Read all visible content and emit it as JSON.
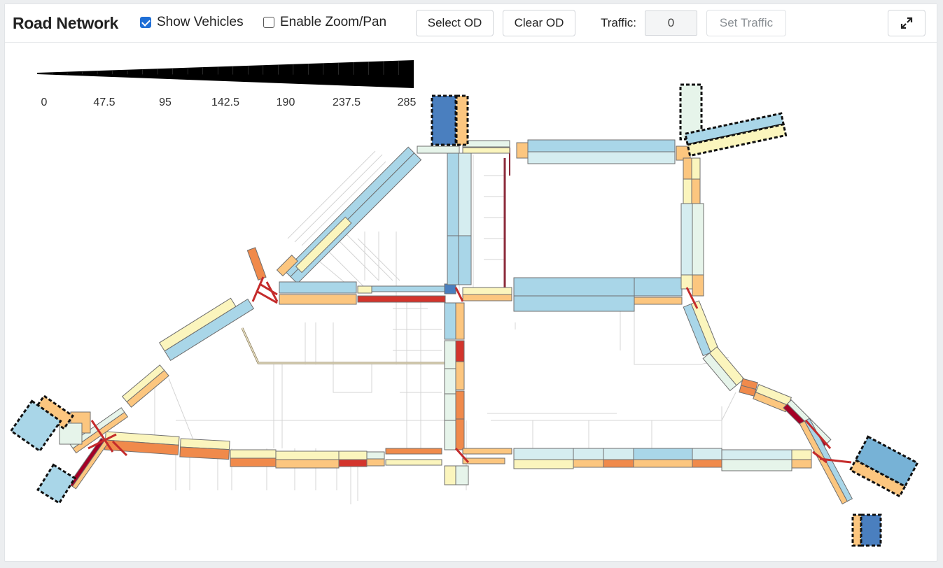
{
  "toolbar": {
    "title": "Road Network",
    "show_vehicles": {
      "label": "Show Vehicles",
      "checked": true
    },
    "enable_zoom_pan": {
      "label": "Enable Zoom/Pan",
      "checked": false
    },
    "select_od_label": "Select OD",
    "clear_od_label": "Clear OD",
    "traffic_label": "Traffic:",
    "traffic_value": "0",
    "set_traffic_label": "Set Traffic",
    "expand_icon": "expand-icon"
  },
  "scale_legend": {
    "tick_labels": [
      "0",
      "47.5",
      "95",
      "142.5",
      "190",
      "237.5",
      "285"
    ],
    "min": 0,
    "max": 285
  },
  "map": {
    "color_scale": [
      "#4a7fbf",
      "#a9d6e8",
      "#e6f4ea",
      "#fbf5bd",
      "#fcc67f",
      "#f08a4b",
      "#d3342c",
      "#a50026"
    ]
  }
}
